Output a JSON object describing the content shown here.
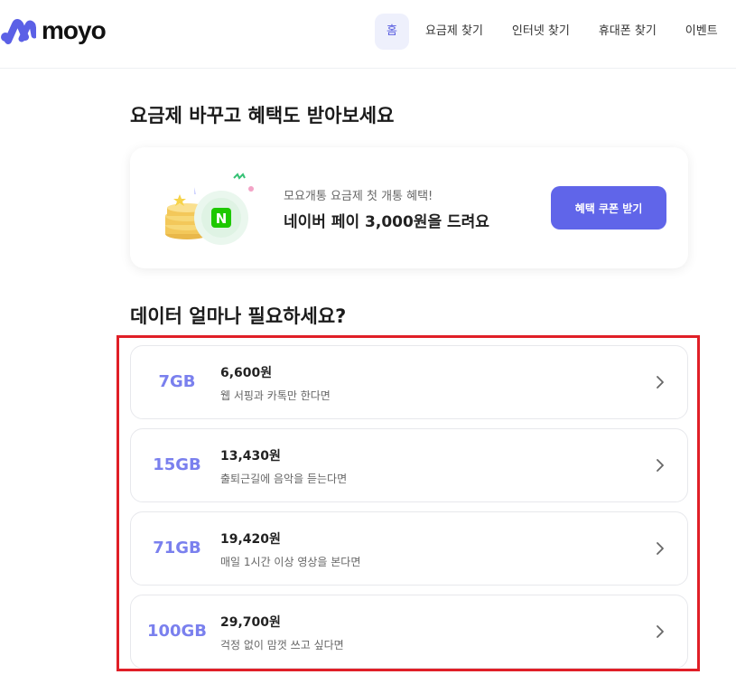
{
  "header": {
    "logo_text": "moyo",
    "nav": [
      {
        "label": "홈",
        "active": true
      },
      {
        "label": "요금제 찾기"
      },
      {
        "label": "인터넷 찾기"
      },
      {
        "label": "휴대폰 찾기"
      },
      {
        "label": "이벤트"
      }
    ]
  },
  "promo_section": {
    "title": "요금제 바꾸고 혜택도 받아보세요",
    "subtitle": "모요개통 요금제 첫 개통 혜택!",
    "headline": "네이버 페이 3,000원을 드려요",
    "button_label": "혜택 쿠폰 받기",
    "badge_letter": "N"
  },
  "data_section": {
    "title": "데이터 얼마나 필요하세요?",
    "plans": [
      {
        "size": "7GB",
        "price": "6,600원",
        "desc": "웹 서핑과 카톡만 한다면"
      },
      {
        "size": "15GB",
        "price": "13,430원",
        "desc": "출퇴근길에 음악을 듣는다면"
      },
      {
        "size": "71GB",
        "price": "19,420원",
        "desc": "매일 1시간 이상 영상을 본다면"
      },
      {
        "size": "100GB",
        "price": "29,700원",
        "desc": "걱정 없이 맘껏 쓰고 싶다면"
      }
    ]
  },
  "colors": {
    "accent": "#6065e9",
    "size_text": "#7a80ee",
    "highlight_border": "#e01f27"
  }
}
